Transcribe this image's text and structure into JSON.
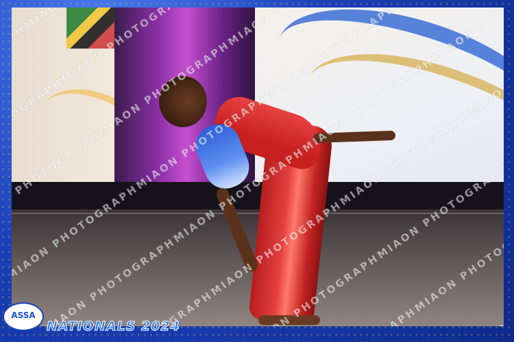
{
  "event_caption": "NATIONALS 2024",
  "logo_text": "ASSA",
  "watermark_text": "MIAON PHOTOGRAPHY",
  "colors": {
    "frame_blue": "#1b3fb0",
    "accent_gold": "#d8b34a",
    "costume_red": "#d42a2a",
    "costume_blue": "#2c5fd6"
  }
}
